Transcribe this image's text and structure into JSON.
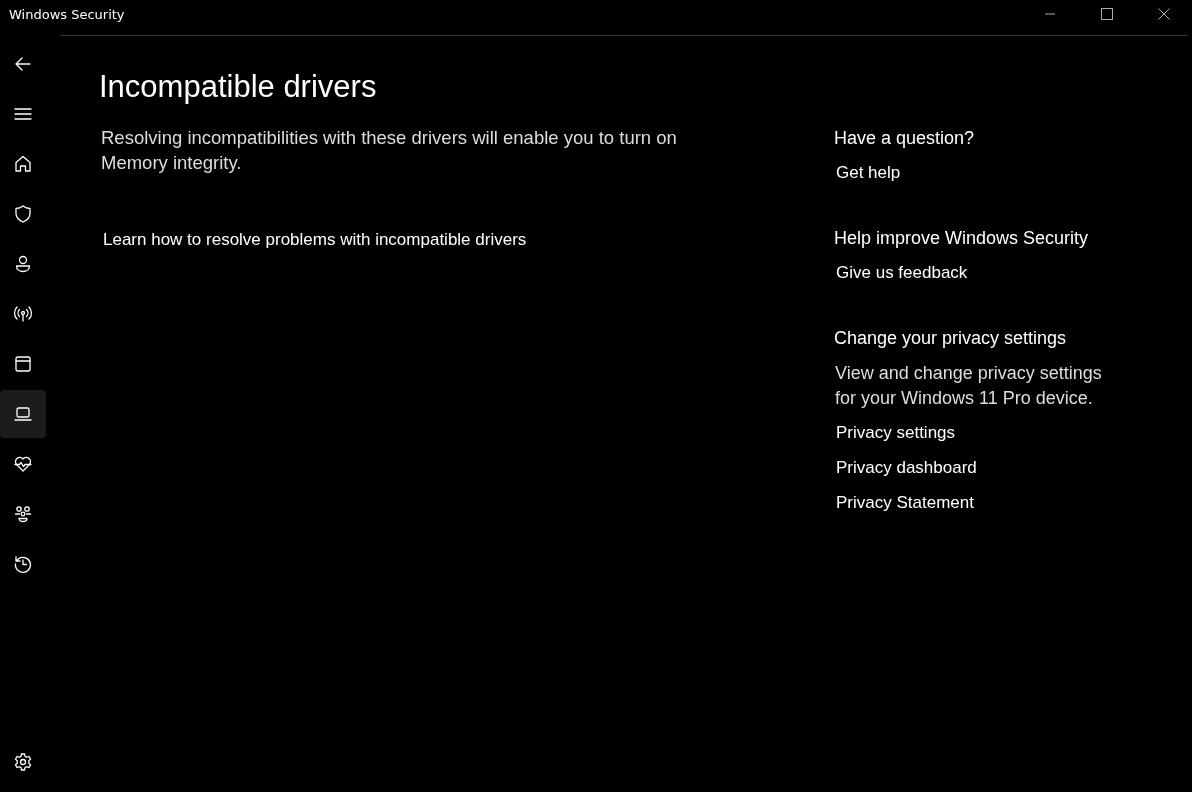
{
  "window": {
    "title": "Windows Security"
  },
  "nav": [
    {
      "kind": "back",
      "selected": false
    },
    {
      "kind": "menu",
      "selected": false
    },
    {
      "kind": "home",
      "selected": false
    },
    {
      "kind": "shield",
      "selected": false
    },
    {
      "kind": "person",
      "selected": false
    },
    {
      "kind": "antenna",
      "selected": false
    },
    {
      "kind": "window",
      "selected": false
    },
    {
      "kind": "laptop",
      "selected": true
    },
    {
      "kind": "heart",
      "selected": false
    },
    {
      "kind": "family",
      "selected": false
    },
    {
      "kind": "history",
      "selected": false
    }
  ],
  "main": {
    "title": "Incompatible drivers",
    "description": "Resolving incompatibilities with these drivers will enable you to turn on Memory integrity.",
    "link": "Learn how to resolve problems with incompatible drivers"
  },
  "side": [
    {
      "heading": "Have a question?",
      "links": [
        "Get help"
      ]
    },
    {
      "heading": "Help improve Windows Security",
      "links": [
        "Give us feedback"
      ]
    },
    {
      "heading": "Change your privacy settings",
      "text": "View and change privacy settings for your Windows 11 Pro device.",
      "links": [
        "Privacy settings",
        "Privacy dashboard",
        "Privacy Statement"
      ]
    }
  ]
}
